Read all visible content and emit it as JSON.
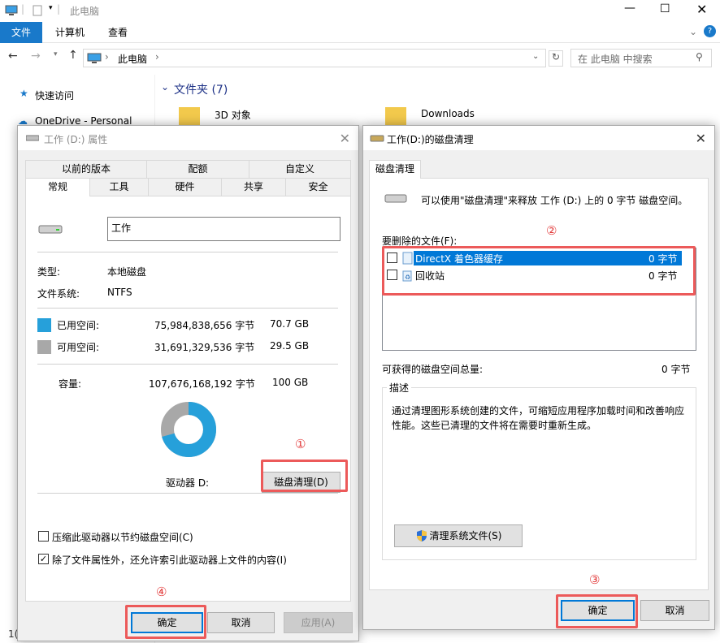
{
  "explorer": {
    "title": "此电脑",
    "ribbon_tabs": [
      "文件",
      "计算机",
      "查看"
    ],
    "address": "此电脑",
    "search_placeholder": "在 此电脑 中搜索",
    "nav_items": [
      "快速访问",
      "OneDrive - Personal"
    ],
    "folders_header": "文件夹 (7)",
    "folders": [
      "3D 对象",
      "Downloads"
    ],
    "status_count": "1("
  },
  "props_dialog": {
    "title": "工作 (D:) 属性",
    "tabs_row1": [
      "以前的版本",
      "配额",
      "自定义"
    ],
    "tabs_row2": [
      "常规",
      "工具",
      "硬件",
      "共享",
      "安全"
    ],
    "name_value": "工作",
    "type_label": "类型:",
    "type_value": "本地磁盘",
    "fs_label": "文件系统:",
    "fs_value": "NTFS",
    "used_label": "已用空间:",
    "used_bytes": "75,984,838,656 字节",
    "used_gb": "70.7 GB",
    "free_label": "可用空间:",
    "free_bytes": "31,691,329,536 字节",
    "free_gb": "29.5 GB",
    "cap_label": "容量:",
    "cap_bytes": "107,676,168,192 字节",
    "cap_gb": "100 GB",
    "used_fraction": 0.706,
    "used_color": "#26a0da",
    "free_color": "#a8a8a8",
    "drive_label": "驱动器 D:",
    "cleanup_button": "磁盘清理(D)",
    "compress_label": "压缩此驱动器以节约磁盘空间(C)",
    "index_label": "除了文件属性外，还允许索引此驱动器上文件的内容(I)",
    "ok": "确定",
    "cancel": "取消",
    "apply": "应用(A)",
    "marker_1": "①",
    "marker_4": "④"
  },
  "cleanup_dialog": {
    "title": "工作(D:)的磁盘清理",
    "tab": "磁盘清理",
    "intro": "可以使用\"磁盘清理\"来释放 工作 (D:) 上的 0 字节 磁盘空间。",
    "files_label": "要删除的文件(F):",
    "files": [
      {
        "name": "DirectX 着色器缓存",
        "size": "0 字节",
        "selected": true
      },
      {
        "name": "回收站",
        "size": "0 字节",
        "selected": false
      }
    ],
    "total_label": "可获得的磁盘空间总量:",
    "total_value": "0 字节",
    "desc_label": "描述",
    "desc_text": "通过清理图形系统创建的文件，可缩短应用程序加载时间和改善响应性能。这些已清理的文件将在需要时重新生成。",
    "sys_button": "清理系统文件(S)",
    "ok": "确定",
    "cancel": "取消",
    "marker_2": "②",
    "marker_3": "③"
  }
}
